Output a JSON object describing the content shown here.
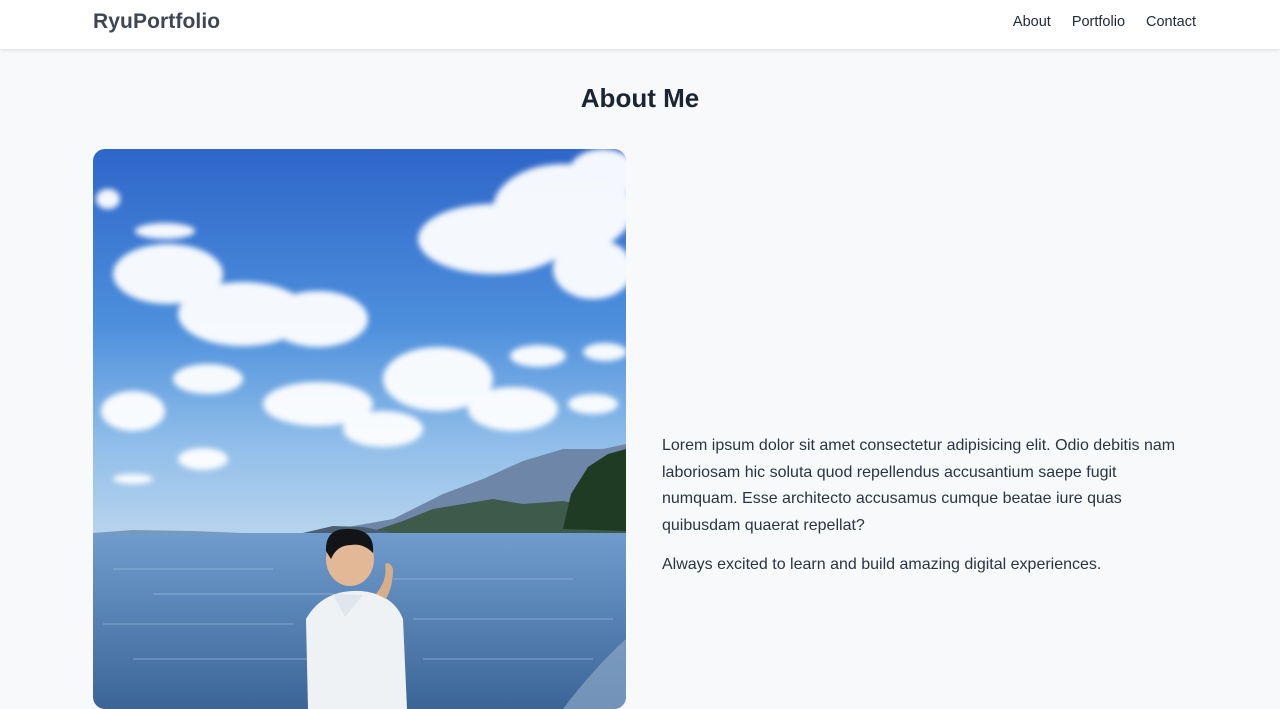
{
  "navbar": {
    "brand": "RyuPortfolio",
    "links": [
      {
        "label": "About"
      },
      {
        "label": "Portfolio"
      },
      {
        "label": "Contact"
      }
    ]
  },
  "about": {
    "title": "About Me",
    "paragraphs": [
      "Lorem ipsum dolor sit amet consectetur adipisicing elit. Odio debitis nam laboriosam hic soluta quod repellendus accusantium saepe fugit numquam. Esse architecto accusamus cumque beatae iure quas quibusdam quaerat repellat?",
      "Always excited to learn and build amazing digital experiences."
    ]
  },
  "colors": {
    "page_background": "#f8f9fb",
    "navbar_background": "#ffffff",
    "heading": "#1b2433",
    "text": "#2b3442"
  }
}
